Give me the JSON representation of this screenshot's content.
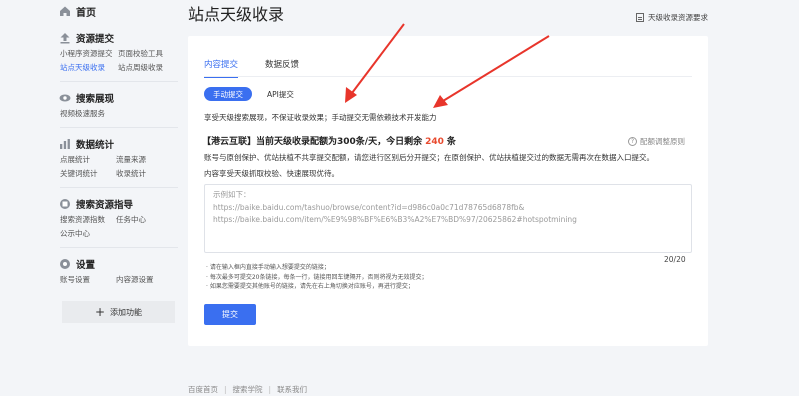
{
  "sidebar": {
    "home": "首页",
    "sections": [
      {
        "title": "资源提交",
        "icon": "upload-icon",
        "items": [
          "小程序资源提交",
          "页面校验工具",
          "站点天级收录",
          "站点周级收录"
        ]
      },
      {
        "title": "搜索展现",
        "icon": "eye-icon",
        "items": [
          "视频极速服务"
        ]
      },
      {
        "title": "数据统计",
        "icon": "bar-chart-icon",
        "items": [
          "点展统计",
          "流量来源",
          "关键词统计",
          "收录统计"
        ]
      },
      {
        "title": "搜索资源指导",
        "icon": "book-icon",
        "items": [
          "搜索资源指数",
          "任务中心",
          "公示中心"
        ]
      },
      {
        "title": "设置",
        "icon": "gear-icon",
        "items": [
          "账号设置",
          "内容源设置"
        ]
      }
    ],
    "add_label": "添加功能"
  },
  "header": {
    "title": "站点天级收录",
    "requirements_link": "天级收录资源要求"
  },
  "tabs": [
    "内容提交",
    "数据反馈"
  ],
  "subtabs": [
    "手动提交",
    "API提交"
  ],
  "description": "享受天级搜索展现，不保证收录效果；手动提交无需依赖技术开发能力",
  "quota": {
    "prefix": "【港云互联】当前天级收录配额为300条/天，今日剩余",
    "remaining": "240",
    "suffix": "条"
  },
  "rule_link": "配额调整原则",
  "note1": "账号与原创保护、优站扶植不共享提交配额，请您进行区别后分开提交；在原创保护、优站扶植提交过的数据无需再次在数据入口提交。",
  "note2": "内容享受天级抓取校验、快速展现优待。",
  "textarea": {
    "placeholder_lines": [
      "示例如下：",
      "https://baike.baidu.com/tashuo/browse/content?id=d986c0a0c71d78765d6878fb&",
      "https://baike.baidu.com/item/%E9%98%BF%E6%B3%A2%E7%BD%97/20625862#hotspotmining"
    ],
    "counter": "20/20"
  },
  "tips": [
    "· 请在输入框内直接手动输入想要提交的链接；",
    "· 每次最多可提交20条链接，每条一行，链接用回车键隔开，否则将视为无效提交；",
    "· 如果您需要提交其他账号的链接，请先在右上角切换对应账号，再进行提交；"
  ],
  "submit_label": "提交",
  "footer": [
    "百度首页",
    "搜索学院",
    "联系我们"
  ],
  "colors": {
    "accent": "#3a6ff0",
    "highlight": "#e84a2e",
    "arrow": "#e8352b"
  }
}
